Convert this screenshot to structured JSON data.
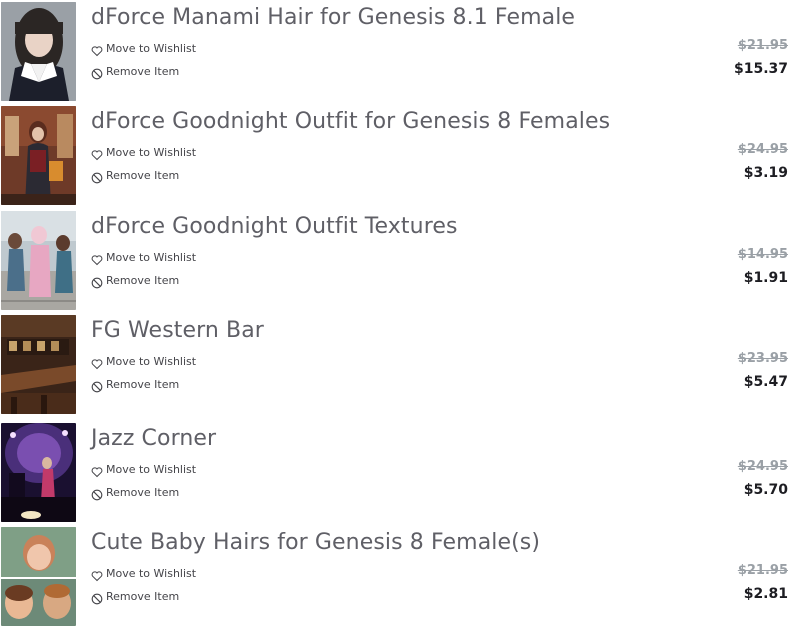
{
  "cart": {
    "items": [
      {
        "title": "dForce Manami Hair for Genesis 8.1 Female",
        "wishlist_label": "Move to Wishlist",
        "remove_label": "Remove Item",
        "original_price": "$21.95",
        "sale_price": "$15.37"
      },
      {
        "title": "dForce Goodnight Outfit for Genesis 8 Females",
        "wishlist_label": "Move to Wishlist",
        "remove_label": "Remove Item",
        "original_price": "$24.95",
        "sale_price": "$3.19"
      },
      {
        "title": "dForce Goodnight Outfit Textures",
        "wishlist_label": "Move to Wishlist",
        "remove_label": "Remove Item",
        "original_price": "$14.95",
        "sale_price": "$1.91"
      },
      {
        "title": "FG Western Bar",
        "wishlist_label": "Move to Wishlist",
        "remove_label": "Remove Item",
        "original_price": "$23.95",
        "sale_price": "$5.47"
      },
      {
        "title": "Jazz Corner",
        "wishlist_label": "Move to Wishlist",
        "remove_label": "Remove Item",
        "original_price": "$24.95",
        "sale_price": "$5.70"
      },
      {
        "title": "Cute Baby Hairs for Genesis 8 Female(s)",
        "wishlist_label": "Move to Wishlist",
        "remove_label": "Remove Item",
        "original_price": "$21.95",
        "sale_price": "$2.81"
      }
    ]
  },
  "icons": {
    "wishlist": "heart-icon",
    "remove": "prohibited-icon"
  },
  "colors": {
    "title": "#5f5f66",
    "action_text": "#444449",
    "old_price": "#9aa0a6",
    "sale_price": "#1d1d22"
  }
}
